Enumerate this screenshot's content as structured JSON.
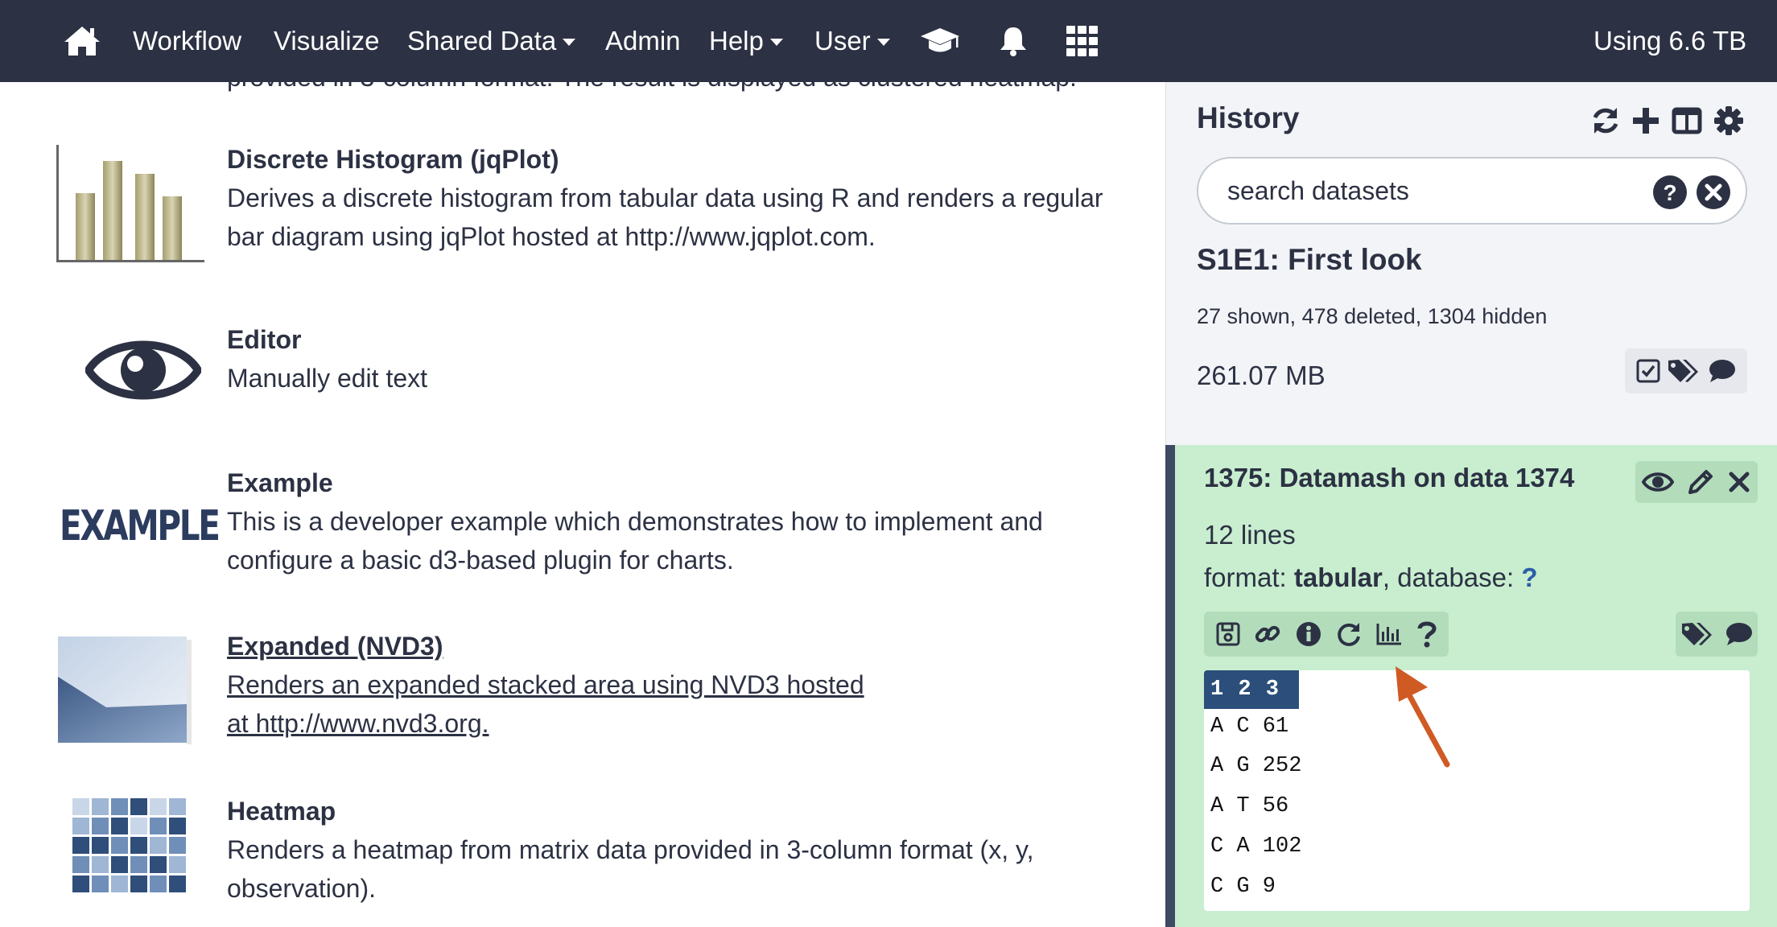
{
  "navbar": {
    "items": [
      "Workflow",
      "Visualize",
      "Shared Data",
      "Admin",
      "Help",
      "User"
    ],
    "usage": "Using 6.6 TB",
    "icons": [
      "home-icon",
      "graduation-cap-icon",
      "bell-icon",
      "grid-icon"
    ]
  },
  "plugins": {
    "cut_off_text": "provided in 3-column format. The result is displayed as clustered heatmap.",
    "items": [
      {
        "title": "Discrete Histogram (jqPlot)",
        "description": "Derives a discrete histogram from tabular data using R and renders a regular bar diagram using jqPlot hosted at http://www.jqplot.com."
      },
      {
        "title": "Editor",
        "description": "Manually edit text"
      },
      {
        "title": "Example",
        "description": "This is a developer example which demonstrates how to implement and configure a basic d3-based plugin for charts.",
        "logo_text": "EXAMPLE"
      },
      {
        "title": "Expanded (NVD3)",
        "description": "Renders an expanded stacked area using NVD3 hosted at http://www.nvd3.org."
      },
      {
        "title": "Heatmap",
        "description": "Renders a heatmap from matrix data provided in 3-column format (x, y, observation)."
      }
    ]
  },
  "history": {
    "title": "History",
    "search_placeholder": "search datasets",
    "name": "S1E1: First look",
    "stats": "27 shown, 478 deleted, 1304 hidden",
    "size": "261.07 MB"
  },
  "dataset": {
    "title": "1375: Datamash on data 1374",
    "lines": "12 lines",
    "format_label": "format: ",
    "format_value": "tabular",
    "database_label": ", database: ",
    "database_value": "?",
    "peek_header": "1 2 3",
    "peek_rows": [
      "A C 61",
      "A G 252",
      "A T 56",
      "C A 102",
      "C G 9"
    ]
  },
  "colors": {
    "navbar": "#2c3143",
    "dataset_ok": "#c8eecf",
    "annotation_arrow": "#d05a24"
  }
}
